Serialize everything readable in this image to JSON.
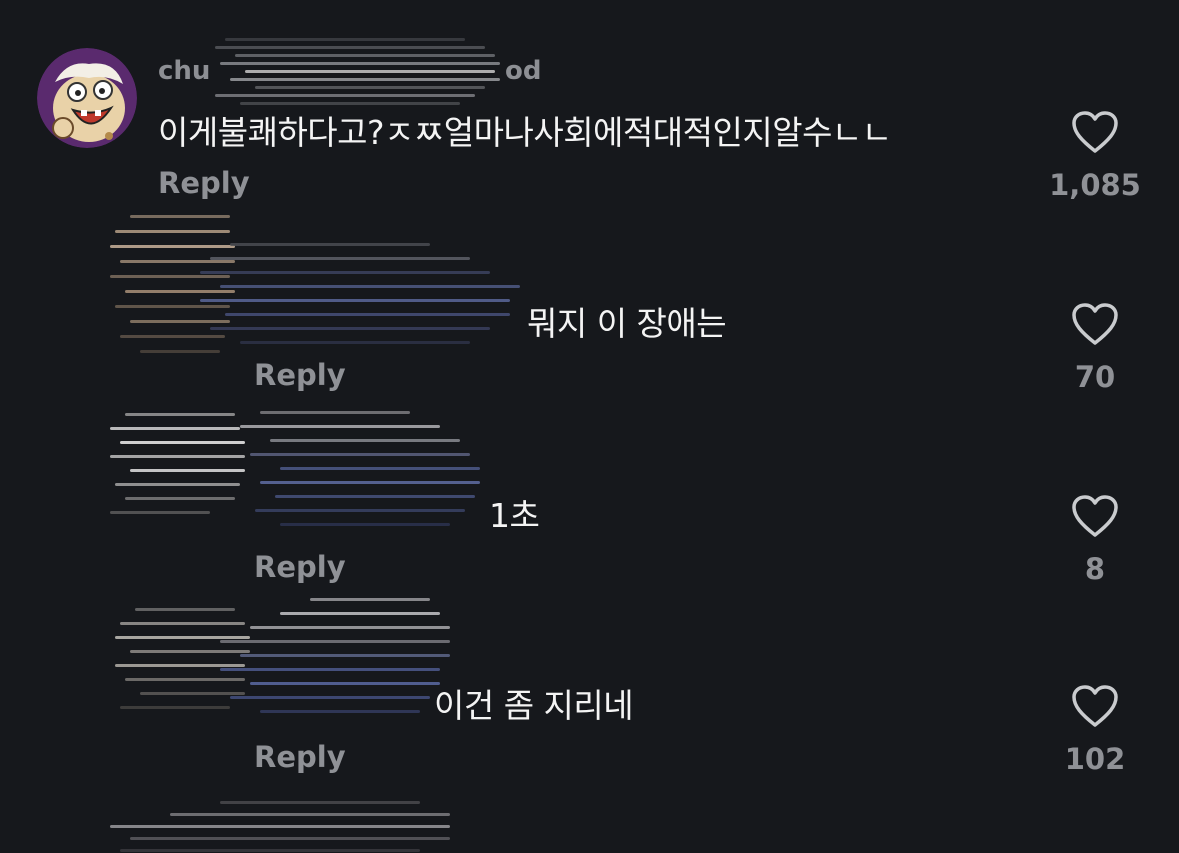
{
  "comments": [
    {
      "username": "chu",
      "username_tail": "od",
      "text": "이게불쾌하다고?ㅈㅉ얼마나사회에적대적인지알수ㄴㄴ",
      "reply_label": "Reply",
      "likes": "1,085"
    },
    {
      "username": "",
      "text": "뭐지 이 장애는",
      "reply_label": "Reply",
      "likes": "70"
    },
    {
      "username": "",
      "text": "1초",
      "reply_label": "Reply",
      "likes": "8"
    },
    {
      "username": "",
      "text": "이건 좀 지리네",
      "reply_label": "Reply",
      "likes": "102"
    }
  ],
  "icons": {
    "like": "heart-outline-icon"
  },
  "colors": {
    "background": "#16181c",
    "text": "#f4f4f4",
    "muted": "#8f9196"
  }
}
